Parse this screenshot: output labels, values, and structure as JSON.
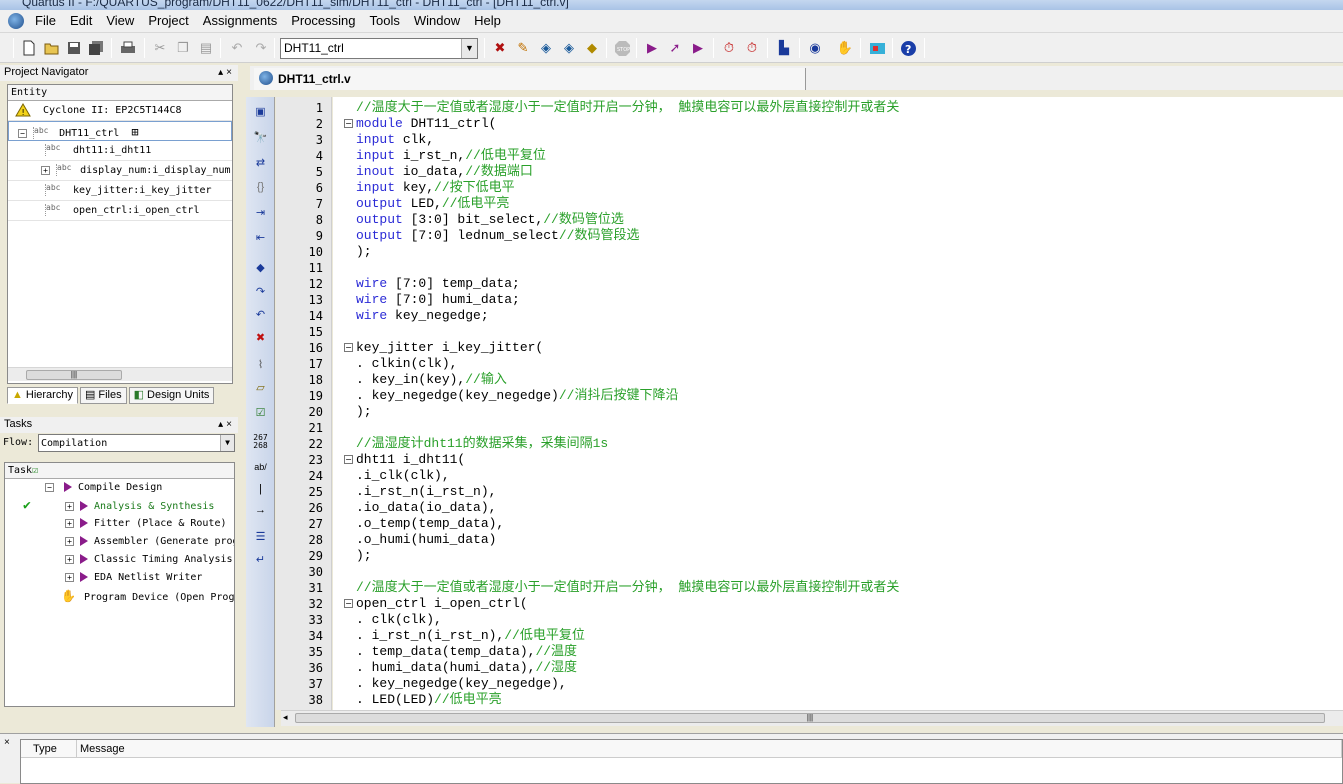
{
  "window": {
    "title": "Quartus II - F:/QUARTUS_program/DHT11_0622/DHT11_sim/DHT11_ctrl - DHT11_ctrl - [DHT11_ctrl.v]"
  },
  "menu": [
    "File",
    "Edit",
    "View",
    "Project",
    "Assignments",
    "Processing",
    "Tools",
    "Window",
    "Help"
  ],
  "toolbar": {
    "entity_combo": "DHT11_ctrl"
  },
  "navigator": {
    "title": "Project Navigator",
    "header": "Entity",
    "device": "Cyclone II: EP2C5T144C8",
    "top_entity": "DHT11_ctrl",
    "children": [
      "dht11:i_dht11",
      "display_num:i_display_num",
      "key_jitter:i_key_jitter",
      "open_ctrl:i_open_ctrl"
    ],
    "tabs": [
      "Hierarchy",
      "Files",
      "Design Units"
    ]
  },
  "tasks": {
    "title": "Tasks",
    "flow_label": "Flow:",
    "flow_value": "Compilation",
    "header": "Task",
    "items": [
      "Compile Design",
      "Analysis & Synthesis",
      "Fitter (Place & Route)",
      "Assembler (Generate programming files)",
      "Classic Timing Analysis",
      "EDA Netlist Writer",
      "Program Device (Open Programmer)"
    ]
  },
  "editor": {
    "tab_label": "DHT11_ctrl.v",
    "sidebar_numbers": [
      "267",
      "268"
    ],
    "sidebar_ab": "ab/",
    "lines": [
      {
        "n": "1",
        "parts": [
          [
            "cm",
            "//温度大于一定值或者湿度小于一定值时开启一分钟， 触摸电容可以最外层直接控制开或者关"
          ]
        ]
      },
      {
        "n": "2",
        "fold": true,
        "parts": [
          [
            "kw",
            "module"
          ],
          [
            "tx",
            " DHT11_ctrl("
          ]
        ]
      },
      {
        "n": "3",
        "parts": [
          [
            "kw",
            "input"
          ],
          [
            "tx",
            " clk,"
          ]
        ]
      },
      {
        "n": "4",
        "parts": [
          [
            "kw",
            "input"
          ],
          [
            "tx",
            " i_rst_n,"
          ],
          [
            "cm",
            "//低电平复位"
          ]
        ]
      },
      {
        "n": "5",
        "parts": [
          [
            "kw",
            "inout"
          ],
          [
            "tx",
            " io_data,"
          ],
          [
            "cm",
            "//数据端口"
          ]
        ]
      },
      {
        "n": "6",
        "parts": [
          [
            "kw",
            "input"
          ],
          [
            "tx",
            " key,"
          ],
          [
            "cm",
            "//按下低电平"
          ]
        ]
      },
      {
        "n": "7",
        "parts": [
          [
            "kw",
            "output"
          ],
          [
            "tx",
            " LED,"
          ],
          [
            "cm",
            "//低电平亮"
          ]
        ]
      },
      {
        "n": "8",
        "parts": [
          [
            "kw",
            "output"
          ],
          [
            "tx",
            " [3:0] bit_select,"
          ],
          [
            "cm",
            "//数码管位选"
          ]
        ]
      },
      {
        "n": "9",
        "parts": [
          [
            "kw",
            "output"
          ],
          [
            "tx",
            " [7:0] lednum_select"
          ],
          [
            "cm",
            "//数码管段选"
          ]
        ]
      },
      {
        "n": "10",
        "parts": [
          [
            "tx",
            ");"
          ]
        ]
      },
      {
        "n": "11",
        "parts": []
      },
      {
        "n": "12",
        "parts": [
          [
            "kw",
            "wire"
          ],
          [
            "tx",
            " [7:0] temp_data;"
          ]
        ]
      },
      {
        "n": "13",
        "parts": [
          [
            "kw",
            "wire"
          ],
          [
            "tx",
            " [7:0] humi_data;"
          ]
        ]
      },
      {
        "n": "14",
        "parts": [
          [
            "kw",
            "wire"
          ],
          [
            "tx",
            " key_negedge;"
          ]
        ]
      },
      {
        "n": "15",
        "parts": []
      },
      {
        "n": "16",
        "fold": true,
        "parts": [
          [
            "tx",
            "key_jitter i_key_jitter("
          ]
        ]
      },
      {
        "n": "17",
        "parts": [
          [
            "tx",
            ". clkin(clk),"
          ]
        ]
      },
      {
        "n": "18",
        "parts": [
          [
            "tx",
            ". key_in(key),"
          ],
          [
            "cm",
            "//输入"
          ]
        ]
      },
      {
        "n": "19",
        "parts": [
          [
            "tx",
            ". key_negedge(key_negedge)"
          ],
          [
            "cm",
            "//消抖后按键下降沿"
          ]
        ]
      },
      {
        "n": "20",
        "parts": [
          [
            "tx",
            ");"
          ]
        ]
      },
      {
        "n": "21",
        "parts": []
      },
      {
        "n": "22",
        "parts": [
          [
            "cm",
            "//温湿度计dht11的数据采集，采集间隔1s"
          ]
        ]
      },
      {
        "n": "23",
        "fold": true,
        "parts": [
          [
            "tx",
            "dht11 i_dht11("
          ]
        ]
      },
      {
        "n": "24",
        "parts": [
          [
            "tx",
            ".i_clk(clk),"
          ]
        ]
      },
      {
        "n": "25",
        "parts": [
          [
            "tx",
            ".i_rst_n(i_rst_n),"
          ]
        ]
      },
      {
        "n": "26",
        "parts": [
          [
            "tx",
            ".io_data(io_data),"
          ]
        ]
      },
      {
        "n": "27",
        "parts": [
          [
            "tx",
            ".o_temp(temp_data),"
          ]
        ]
      },
      {
        "n": "28",
        "parts": [
          [
            "tx",
            ".o_humi(humi_data)"
          ]
        ]
      },
      {
        "n": "29",
        "parts": [
          [
            "tx",
            ");"
          ]
        ]
      },
      {
        "n": "30",
        "parts": []
      },
      {
        "n": "31",
        "parts": [
          [
            "cm",
            "//温度大于一定值或者湿度小于一定值时开启一分钟， 触摸电容可以最外层直接控制开或者关"
          ]
        ]
      },
      {
        "n": "32",
        "fold": true,
        "parts": [
          [
            "tx",
            "open_ctrl i_open_ctrl("
          ]
        ]
      },
      {
        "n": "33",
        "parts": [
          [
            "tx",
            ". clk(clk),"
          ]
        ]
      },
      {
        "n": "34",
        "parts": [
          [
            "tx",
            ". i_rst_n(i_rst_n),"
          ],
          [
            "cm",
            "//低电平复位"
          ]
        ]
      },
      {
        "n": "35",
        "parts": [
          [
            "tx",
            ". temp_data(temp_data),"
          ],
          [
            "cm",
            "//温度"
          ]
        ]
      },
      {
        "n": "36",
        "parts": [
          [
            "tx",
            ". humi_data(humi_data),"
          ],
          [
            "cm",
            "//湿度"
          ]
        ]
      },
      {
        "n": "37",
        "parts": [
          [
            "tx",
            ". key_negedge(key_negedge),"
          ]
        ]
      },
      {
        "n": "38",
        "parts": [
          [
            "tx",
            ". LED(LED)"
          ],
          [
            "cm",
            "//低电平亮"
          ]
        ]
      }
    ]
  },
  "messages": {
    "col_type": "Type",
    "col_message": "Message"
  },
  "colors": {
    "keyword": "#2b2bd6",
    "comment": "#2aa02a",
    "task_arrow": "#8a1c8a"
  }
}
